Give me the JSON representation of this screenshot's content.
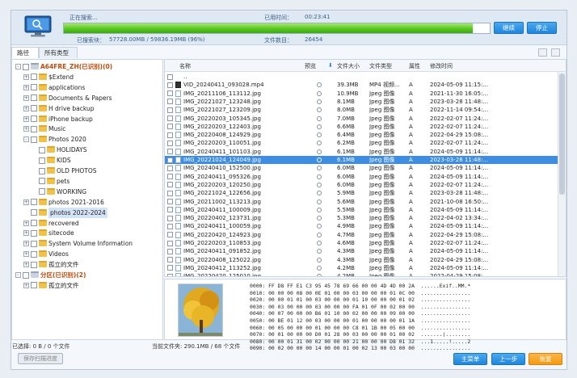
{
  "header": {
    "status_label": "正在搜索...",
    "elapsed_label": "已用时间：",
    "elapsed_value": "00:23:41",
    "scanned_label": "已搜索块：",
    "scanned_value": "57728.00MB / 59836.19MB (96%)",
    "files_label": "文件数目：",
    "files_value": "26454",
    "progress": 0.96,
    "continue_label": "继续",
    "stop_label": "停止"
  },
  "tabs": [
    "路径",
    "所有类型"
  ],
  "tree": [
    {
      "label": "A64FRE_ZH(已识别)(0)",
      "level": 0,
      "red": true,
      "exp": "-"
    },
    {
      "label": "$Extend",
      "level": 1,
      "exp": "+"
    },
    {
      "label": "applications",
      "level": 1,
      "exp": "+"
    },
    {
      "label": "Documents & Papers",
      "level": 1,
      "exp": "+"
    },
    {
      "label": "H drive backup",
      "level": 1,
      "exp": "+"
    },
    {
      "label": "iPhone backup",
      "level": 1,
      "exp": "+"
    },
    {
      "label": "Music",
      "level": 1,
      "exp": "+"
    },
    {
      "label": "Photos 2020",
      "level": 1,
      "exp": "-"
    },
    {
      "label": "HOLIDAYS",
      "level": 2,
      "exp": ""
    },
    {
      "label": "KIDS",
      "level": 2,
      "exp": ""
    },
    {
      "label": "OLD PHOTOS",
      "level": 2,
      "exp": ""
    },
    {
      "label": "pets",
      "level": 2,
      "exp": ""
    },
    {
      "label": "WORKING",
      "level": 2,
      "exp": ""
    },
    {
      "label": "photos 2021-2016",
      "level": 1,
      "exp": "+"
    },
    {
      "label": "photos 2022-2024",
      "level": 1,
      "exp": "",
      "sel": true
    },
    {
      "label": "recovered",
      "level": 1,
      "exp": "+"
    },
    {
      "label": "sitecode",
      "level": 1,
      "exp": "+"
    },
    {
      "label": "System Volume Information",
      "level": 1,
      "exp": "+"
    },
    {
      "label": "Videos",
      "level": 1,
      "exp": "+"
    },
    {
      "label": "孤立的文件",
      "level": 1,
      "exp": "+"
    },
    {
      "label": "分区(已识别)(2)",
      "level": 0,
      "red": true,
      "exp": "-"
    },
    {
      "label": "孤立的文件",
      "level": 1,
      "exp": "+"
    }
  ],
  "columns": {
    "name": "名称",
    "preview": "预览",
    "size": "文件大小",
    "type": "文件类型",
    "attr": "属性",
    "mtime": "修改时间"
  },
  "files": [
    {
      "name": "..",
      "size": "",
      "type": "",
      "attr": "",
      "mtime": "",
      "parent": true
    },
    {
      "name": "VID_20240411_093028.mp4",
      "size": "39.3MB",
      "type": "MP4 视频...",
      "attr": "A",
      "mtime": "2024-05-09 11:15:...",
      "video": true
    },
    {
      "name": "IMG_20211106_113112.jpg",
      "size": "10.9MB",
      "type": "Jpeg 图像",
      "attr": "A",
      "mtime": "2021-11-30 16:05:..."
    },
    {
      "name": "IMG_20221027_123248.jpg",
      "size": "8.1MB",
      "type": "Jpeg 图像",
      "attr": "A",
      "mtime": "2023-03-28 11:48:..."
    },
    {
      "name": "IMG_20221027_123209.jpg",
      "size": "8.0MB",
      "type": "Jpeg 图像",
      "attr": "A",
      "mtime": "2022-11-14 09:54:..."
    },
    {
      "name": "IMG_20220203_105345.jpg",
      "size": "7.0MB",
      "type": "Jpeg 图像",
      "attr": "A",
      "mtime": "2022-02-07 11:24:..."
    },
    {
      "name": "IMG_20220203_122403.jpg",
      "size": "6.6MB",
      "type": "Jpeg 图像",
      "attr": "A",
      "mtime": "2022-02-07 11:24:..."
    },
    {
      "name": "IMG_20220408_124929.jpg",
      "size": "6.4MB",
      "type": "Jpeg 图像",
      "attr": "A",
      "mtime": "2022-04-29 15:08:..."
    },
    {
      "name": "IMG_20220203_110051.jpg",
      "size": "6.2MB",
      "type": "Jpeg 图像",
      "attr": "A",
      "mtime": "2022-02-07 11:24:..."
    },
    {
      "name": "IMG_20240411_101103.jpg",
      "size": "6.1MB",
      "type": "Jpeg 图像",
      "attr": "A",
      "mtime": "2024-05-09 11:14:..."
    },
    {
      "name": "IMG_20221024_124049.jpg",
      "size": "6.1MB",
      "type": "Jpeg 图像",
      "attr": "A",
      "mtime": "2023-03-28 11:48:...",
      "sel": true
    },
    {
      "name": "IMG_20240410_152500.jpg",
      "size": "6.0MB",
      "type": "Jpeg 图像",
      "attr": "A",
      "mtime": "2024-05-09 11:14:..."
    },
    {
      "name": "IMG_20240411_095326.jpg",
      "size": "6.0MB",
      "type": "Jpeg 图像",
      "attr": "A",
      "mtime": "2024-05-09 11:14:..."
    },
    {
      "name": "IMG_20220203_120250.jpg",
      "size": "6.0MB",
      "type": "Jpeg 图像",
      "attr": "A",
      "mtime": "2022-02-07 11:24:..."
    },
    {
      "name": "IMG_20221024_122656.jpg",
      "size": "5.9MB",
      "type": "Jpeg 图像",
      "attr": "A",
      "mtime": "2023-03-28 11:48:..."
    },
    {
      "name": "IMG_20211002_113213.jpg",
      "size": "5.6MB",
      "type": "Jpeg 图像",
      "attr": "A",
      "mtime": "2021-10-08 16:50:..."
    },
    {
      "name": "IMG_20240411_100009.jpg",
      "size": "5.5MB",
      "type": "Jpeg 图像",
      "attr": "A",
      "mtime": "2024-05-09 11:14:..."
    },
    {
      "name": "IMG_20220402_123731.jpg",
      "size": "5.3MB",
      "type": "Jpeg 图像",
      "attr": "A",
      "mtime": "2022-04-02 13:34:..."
    },
    {
      "name": "IMG_20240411_100059.jpg",
      "size": "4.9MB",
      "type": "Jpeg 图像",
      "attr": "A",
      "mtime": "2024-05-09 11:14:..."
    },
    {
      "name": "IMG_20220420_124923.jpg",
      "size": "4.7MB",
      "type": "Jpeg 图像",
      "attr": "A",
      "mtime": "2022-04-29 15:08:..."
    },
    {
      "name": "IMG_20220203_110853.jpg",
      "size": "4.6MB",
      "type": "Jpeg 图像",
      "attr": "A",
      "mtime": "2022-02-07 11:24:..."
    },
    {
      "name": "IMG_20240411_091852.jpg",
      "size": "4.3MB",
      "type": "Jpeg 图像",
      "attr": "A",
      "mtime": "2024-05-09 11:14:..."
    },
    {
      "name": "IMG_20220408_125022.jpg",
      "size": "4.3MB",
      "type": "Jpeg 图像",
      "attr": "A",
      "mtime": "2022-04-29 15:08:..."
    },
    {
      "name": "IMG_20240412_113252.jpg",
      "size": "4.2MB",
      "type": "Jpeg 图像",
      "attr": "A",
      "mtime": "2024-05-09 11:14:..."
    },
    {
      "name": "IMG_20220420_125010.jpg",
      "size": "4.2MB",
      "type": "Jpeg 图像",
      "attr": "A",
      "mtime": "2022-04-29 15:08:..."
    }
  ],
  "hex": [
    "0000: FF D8 FF E1 C3 95 45 78 69 66 00 00 4D 4D 00 2A  ......Exif..MM.*",
    "0010: 00 00 00 08 00 0E 01 00 00 03 00 00 00 01 0C 00  ................",
    "0020: 00 00 01 01 00 03 00 00 00 01 10 00 00 00 01 02  ................",
    "0030: 00 03 00 00 00 03 00 00 00 FA 01 0F 00 02 00 00  ................",
    "0040: 00 07 00 00 00 B6 01 10 00 02 00 00 00 09 00 00  ................",
    "0050: 00 BE 01 12 00 03 00 00 00 01 00 00 00 00 01 1A  ................",
    "0060: 00 05 00 00 00 01 00 00 00 C8 01 1B 00 05 00 00  ................",
    "0070: 00 01 00 00 00 D0 01 28 00 03 00 00 00 01 00 02  .......(........",
    "0080: 00 00 01 31 00 02 00 00 00 21 00 00 00 D8 01 32  ...1.....!.....2",
    "0090: 00 02 00 00 00 14 00 00 01 00 02 13 00 03 00 00  ................"
  ],
  "status": {
    "selected": "已选择: 0 B / 0 个文件",
    "current_folder": "当前文件夹:  290.1MB / 68 个文件"
  },
  "buttons": {
    "save_progress": "保存扫描进度",
    "main_menu": "主菜单",
    "back": "上一步",
    "recover": "恢复"
  }
}
